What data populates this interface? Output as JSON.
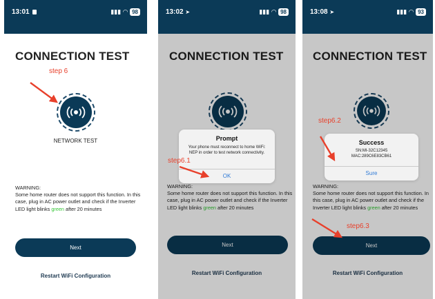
{
  "colors": {
    "header": "#0b3a57",
    "accent_green": "#35c636",
    "annotation_red": "#e8402b",
    "link_blue": "#2f7ad6"
  },
  "icons": {
    "status": "camera-icon, location-arrow-icon, signal-icon, wifi-icon",
    "network": "broadcast-signal-icon"
  },
  "screens": [
    {
      "status": {
        "time": "13:01",
        "battery": "98"
      },
      "title": "CONNECTION TEST",
      "network_label": "NETWORK TEST",
      "warning_title": "WARNING:",
      "warning_text": "Some home router does not support this function. In this case, plug in AC power outlet and check if the Inverter LED light blinks",
      "warning_green": "green",
      "warning_tail": "after 20 minutes",
      "next_label": "Next",
      "restart_label": "Restart WiFi Configuration",
      "annotation": "step 6"
    },
    {
      "status": {
        "time": "13:02",
        "battery": "98"
      },
      "title": "CONNECTION TEST",
      "dialog": {
        "title": "Prompt",
        "message": "Your phone must reconnect to home WiFi: NEP in order to test network connectivity.",
        "button": "OK"
      },
      "warning_title": "WARNING:",
      "warning_text": "Some home router does not support this function. In this case, plug in AC power outlet and check if the Inverter LED light blinks",
      "warning_green": "green",
      "warning_tail": "after 20 minutes",
      "next_label": "Next",
      "restart_label": "Restart WiFi Configuration",
      "annotation": "step6.1"
    },
    {
      "status": {
        "time": "13:08",
        "battery": "93"
      },
      "title": "CONNECTION TEST",
      "dialog": {
        "title": "Success",
        "sn": "SN:MI-32C12345",
        "mac": "MAC:289C6E83CB61",
        "button": "Sure"
      },
      "warning_title": "WARNING:",
      "warning_text": "Some home router does not support this function. In this case, plug in AC power outlet and check if the Inverter LED light blinks",
      "warning_green": "green",
      "warning_tail": "after 20 minutes",
      "next_label": "Next",
      "restart_label": "Restart WiFi Configuration",
      "annotation_a": "step6.2",
      "annotation_b": "step6.3"
    }
  ]
}
